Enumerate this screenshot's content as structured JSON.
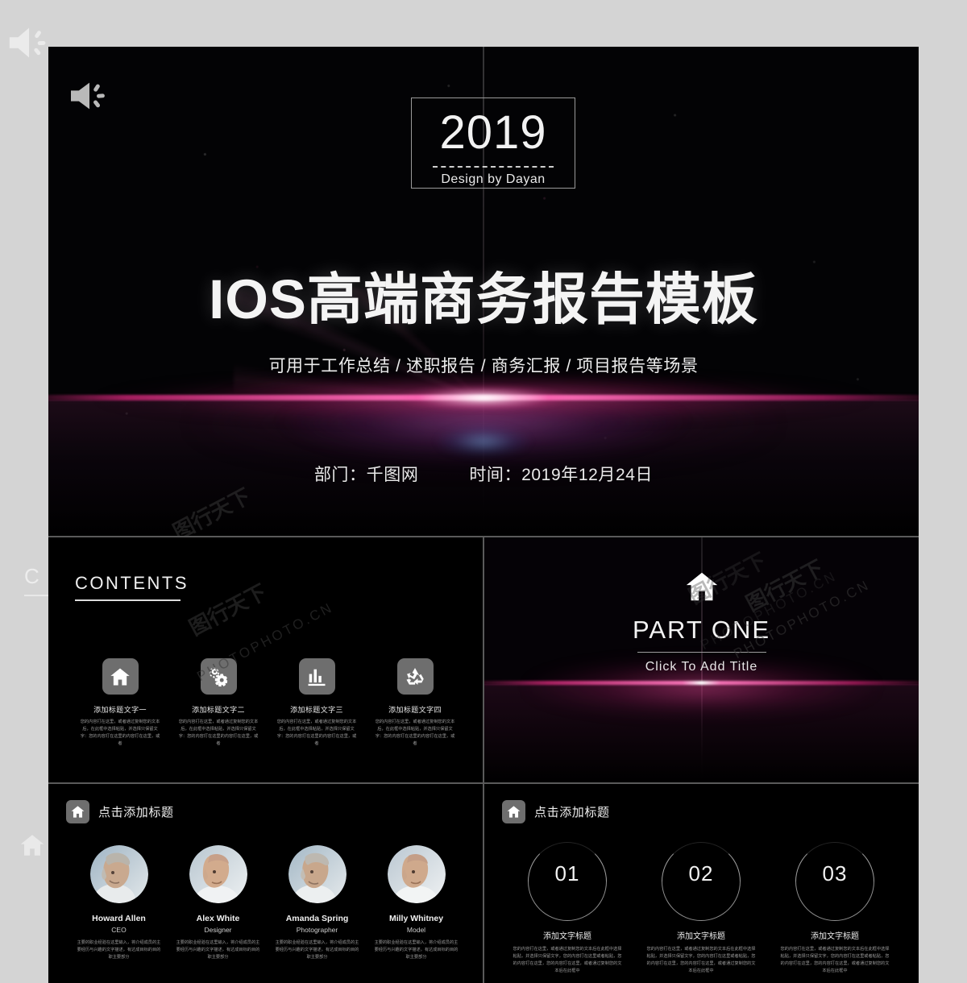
{
  "background": {
    "ghost_contents_label": "C",
    "surface_color": "#d4d4d4"
  },
  "cover": {
    "speaker_icon": "speaker-icon",
    "year": "2019",
    "designer": "Design by Dayan",
    "title": "IOS高端商务报告模板",
    "subtitle": "可用于工作总结 / 述职报告 / 商务汇报 / 项目报告等场景",
    "department": "部门：千图网",
    "date": "时间：2019年12月24日",
    "accent_color": "#ff6eb9"
  },
  "contents": {
    "heading": "CONTENTS",
    "cards": [
      {
        "icon": "home-icon",
        "title": "添加标题文字一",
        "body": "您的内容打在这里，或者通过复制您的文本后，在此框中选择粘贴，并选择只保留文字：您的内容打在这里的内容打在这里，或者"
      },
      {
        "icon": "gears-icon",
        "title": "添加标题文字二",
        "body": "您的内容打在这里，或者通过复制您的文本后，在此框中选择粘贴，并选择只保留文字：您的内容打在这里的内容打在这里，或者"
      },
      {
        "icon": "bar-chart-icon",
        "title": "添加标题文字三",
        "body": "您的内容打在这里，或者通过复制您的文本后，在此框中选择粘贴，并选择只保留文字：您的内容打在这里的内容打在这里，或者"
      },
      {
        "icon": "recycle-icon",
        "title": "添加标题文字四",
        "body": "您的内容打在这里，或者通过复制您的文本后，在此框中选择粘贴，并选择只保留文字：您的内容打在这里的内容打在这里，或者"
      }
    ]
  },
  "part_one": {
    "icon": "home-icon",
    "title": "PART ONE",
    "subtitle": "Click To Add Title"
  },
  "team": {
    "header_icon": "home-icon",
    "header_title": "点击添加标题",
    "members": [
      {
        "name": "Howard Allen",
        "role": "CEO",
        "body": "主要的职业经验在这里输入，将介绍成员的主要经历与兴趣的文字描述，有达成目标的目的职主要部分"
      },
      {
        "name": "Alex White",
        "role": "Designer",
        "body": "主要的职业经验在这里输入，将介绍成员的主要经历与兴趣的文字描述，有达成目标的目的职主要部分"
      },
      {
        "name": "Amanda Spring",
        "role": "Photographer",
        "body": "主要的职业经验在这里输入，将介绍成员的主要经历与兴趣的文字描述，有达成目标的目的职主要部分"
      },
      {
        "name": "Milly Whitney",
        "role": "Model",
        "body": "主要的职业经验在这里输入，将介绍成员的主要经历与兴趣的文字描述，有达成目标的目的职主要部分"
      }
    ]
  },
  "steps": {
    "header_icon": "home-icon",
    "header_title": "点击添加标题",
    "items": [
      {
        "number": "01",
        "title": "添加文字标题",
        "body": "您的内容打在这里，或者通过复制您的文本后在此框中选择粘贴，并选择只保留文字，您的内容打在这里或者粘贴，您的内容打在这里，您的内容打在这里，或者通过复制您的文本后在此框中"
      },
      {
        "number": "02",
        "title": "添加文字标题",
        "body": "您的内容打在这里，或者通过复制您的文本后在此框中选择粘贴，并选择只保留文字，您的内容打在这里或者粘贴，您的内容打在这里，您的内容打在这里，或者通过复制您的文本后在此框中"
      },
      {
        "number": "03",
        "title": "添加文字标题",
        "body": "您的内容打在这里，或者通过复制您的文本后在此框中选择粘贴，并选择只保留文字，您的内容打在这里或者粘贴，您的内容打在这里，您的内容打在这里，或者通过复制您的文本后在此框中"
      }
    ]
  },
  "watermarks": {
    "latin": "PHOTOPHOTO.CN",
    "chinese": "图行天下"
  }
}
